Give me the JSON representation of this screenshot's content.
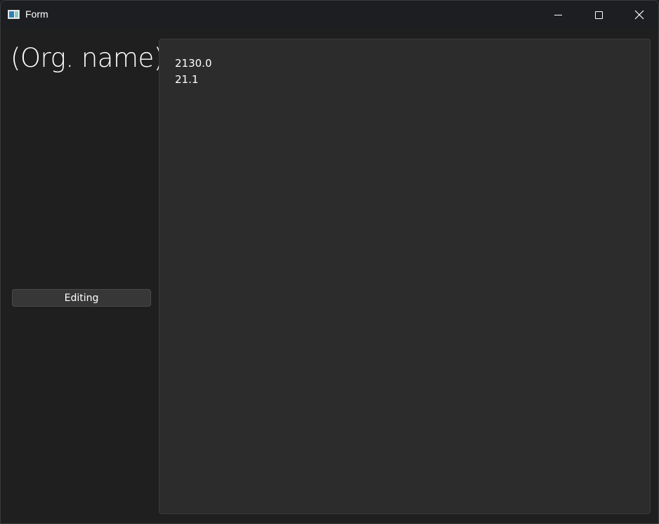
{
  "window": {
    "title": "Form",
    "title_icon": "app-window-icon",
    "controls": {
      "minimize_icon": "minimize-icon",
      "maximize_icon": "maximize-icon",
      "close_icon": "close-icon"
    }
  },
  "sidebar": {
    "org_name": "(Org. name)",
    "edit_button_label": "Editing"
  },
  "main": {
    "values": [
      "2130.0",
      "21.1"
    ]
  },
  "colors": {
    "background": "#1f1f1f",
    "titlebar": "#1d1e22",
    "panel": "#2c2c2c",
    "button": "#373737",
    "text": "#ffffff"
  }
}
